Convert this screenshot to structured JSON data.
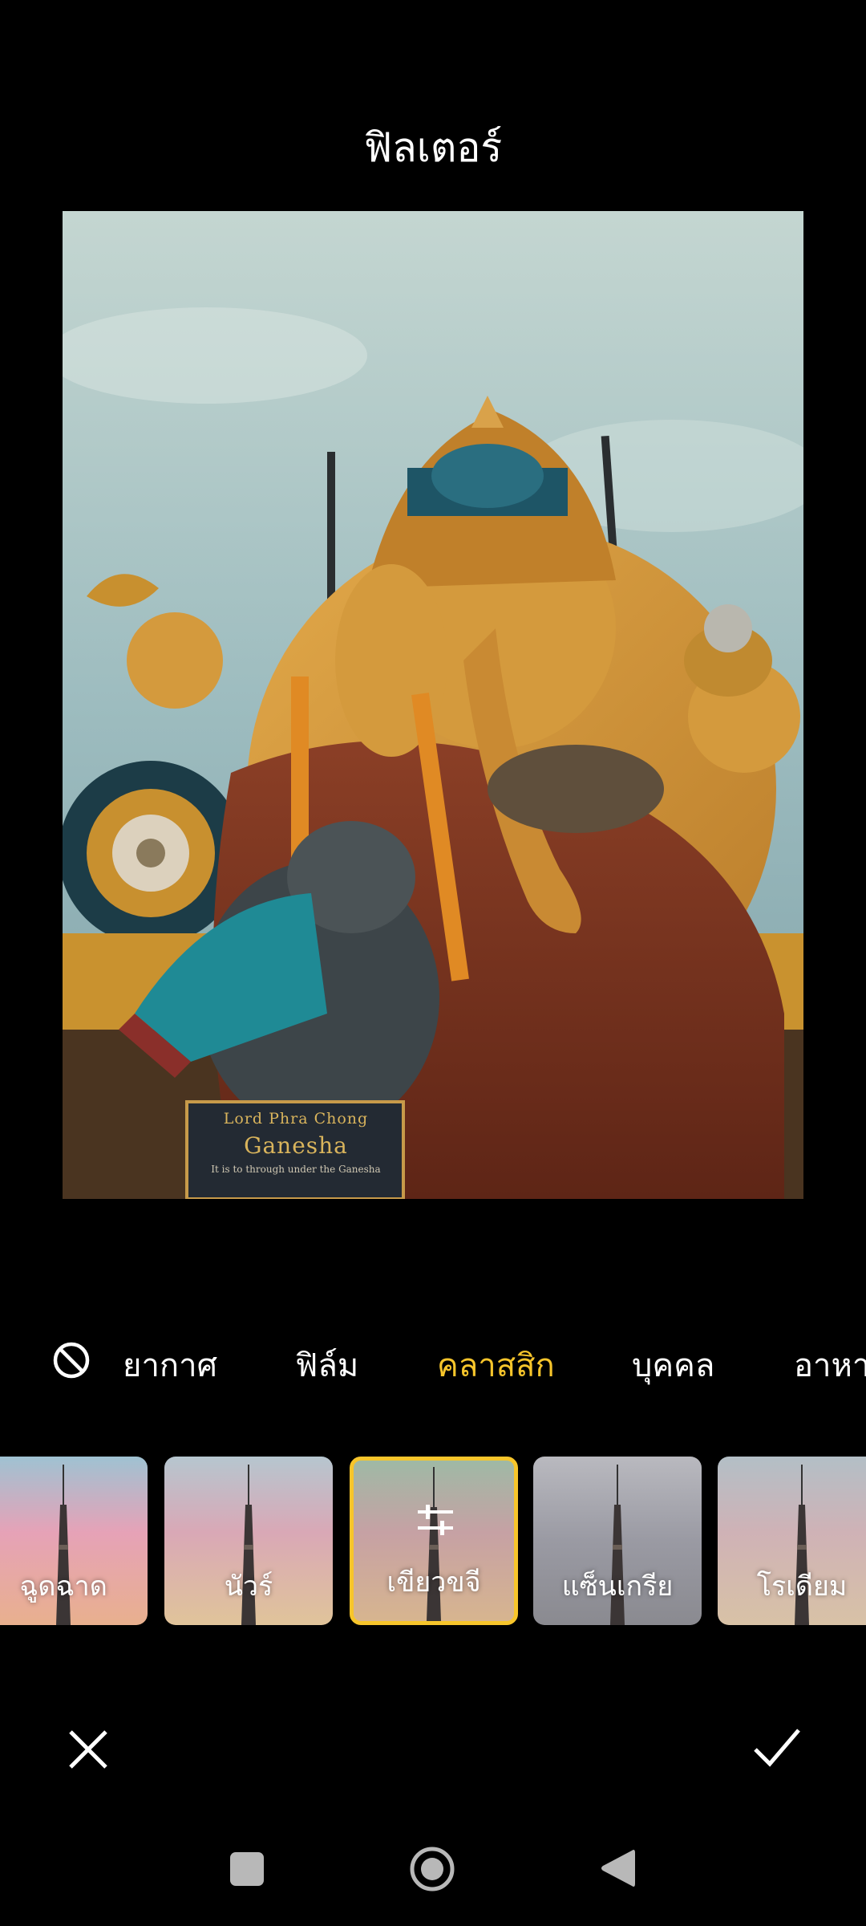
{
  "header": {
    "title": "ฟิลเตอร์"
  },
  "photo": {
    "plaque_line1": "Lord Phra Chong",
    "plaque_line2": "Ganesha",
    "plaque_line3": "It is to through under the Ganesha"
  },
  "categories": {
    "none_icon": "no-filter-icon",
    "items": [
      "ยากาศ",
      "ฟิล์ม",
      "คลาสสิก",
      "บุคคล",
      "อาหาร"
    ],
    "active": "คลาสสิก"
  },
  "filters": {
    "items": [
      "ฉูดฉาด",
      "นัวร์",
      "เขียวขจี",
      "แซ็นเกรีย",
      "โรเดียม"
    ],
    "selected": "เขียวขจี",
    "selected_icon": "adjust-sliders-icon"
  },
  "actions": {
    "cancel_icon": "close-icon",
    "confirm_icon": "checkmark-icon"
  },
  "navbar": {
    "recents_icon": "square-icon",
    "home_icon": "circle-icon",
    "back_icon": "triangle-back-icon"
  },
  "colors": {
    "accent": "#f7c52b",
    "background": "#000000"
  }
}
